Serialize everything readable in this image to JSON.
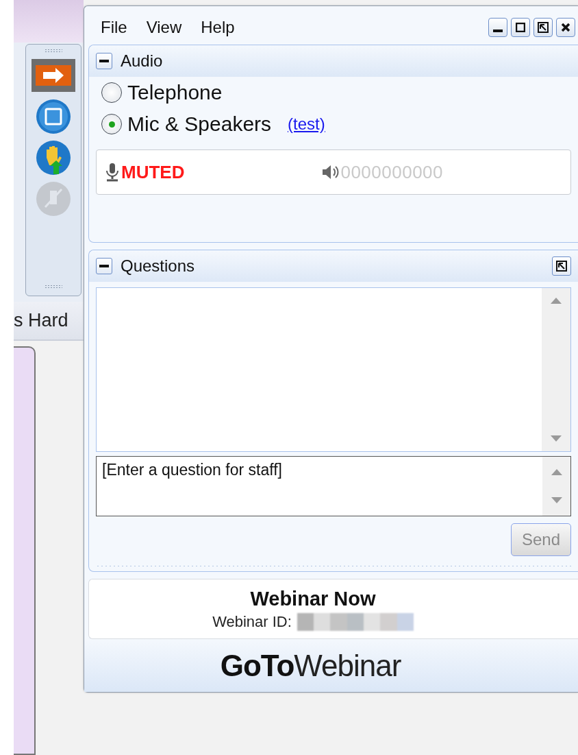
{
  "background": {
    "tab_text": "s Hard"
  },
  "toolbar": [
    {
      "kind": "arrow",
      "disabled": false
    },
    {
      "kind": "screen",
      "disabled": false
    },
    {
      "kind": "hand",
      "disabled": false
    },
    {
      "kind": "mute",
      "disabled": true
    }
  ],
  "menu": [
    "File",
    "View",
    "Help"
  ],
  "audio": {
    "title": "Audio",
    "expanded": true,
    "options": [
      {
        "label": "Telephone",
        "selected": false
      },
      {
        "label": "Mic & Speakers",
        "selected": true
      }
    ],
    "test_link": "(test)",
    "mic_status": "MUTED",
    "speaker_meter": "0000000000"
  },
  "questions": {
    "title": "Questions",
    "expanded": true,
    "input": {
      "placeholder": "[Enter a question for staff]"
    },
    "send_button": {
      "label": "Send",
      "disabled": true
    }
  },
  "webinar": {
    "title": "Webinar Now",
    "id_label": "Webinar ID:"
  },
  "logo": {
    "bold": "GoTo",
    "light": "Webinar"
  }
}
